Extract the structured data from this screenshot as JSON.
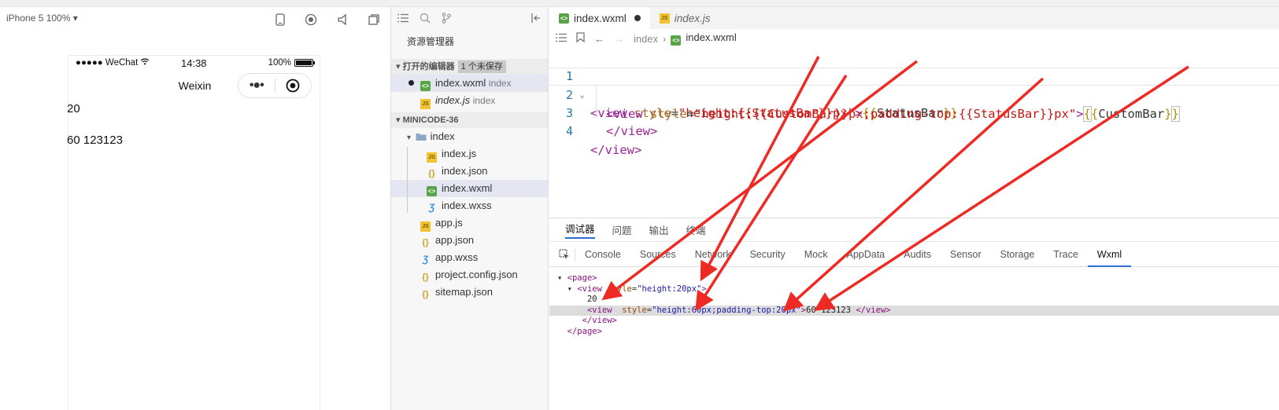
{
  "simulator": {
    "device": "iPhone 5 100% ▾",
    "status": {
      "carrier": "●●●●● WeChat",
      "time": "14:38",
      "battery": "100%"
    },
    "nav_title": "Weixin",
    "capsule_more": "•●•",
    "content_lines": [
      "20",
      "60 123123"
    ]
  },
  "explorer": {
    "title": "资源管理器",
    "open_editors_label": "打开的编辑器",
    "unsaved_badge": "1 个未保存",
    "open_editors": [
      {
        "name": "index.wxml",
        "dir": "index"
      },
      {
        "name": "index.js",
        "dir": "index"
      }
    ],
    "project_label": "MINICODE-36",
    "tree": {
      "folder": "index",
      "folder_files": [
        "index.js",
        "index.json",
        "index.wxml",
        "index.wxss"
      ],
      "root_files": [
        "app.js",
        "app.json",
        "app.wxss",
        "project.config.json",
        "sitemap.json"
      ]
    }
  },
  "editor": {
    "tabs": [
      "index.wxml",
      "index.js"
    ],
    "breadcrumb": [
      "index",
      "index.wxml"
    ],
    "line_numbers": [
      "1",
      "2",
      "3",
      "4"
    ]
  },
  "debugger": {
    "tabs": [
      "调试器",
      "问题",
      "输出",
      "终端"
    ],
    "panel_tabs": [
      "Console",
      "Sources",
      "Network",
      "Security",
      "Mock",
      "AppData",
      "Audits",
      "Sensor",
      "Storage",
      "Trace",
      "Wxml"
    ]
  }
}
